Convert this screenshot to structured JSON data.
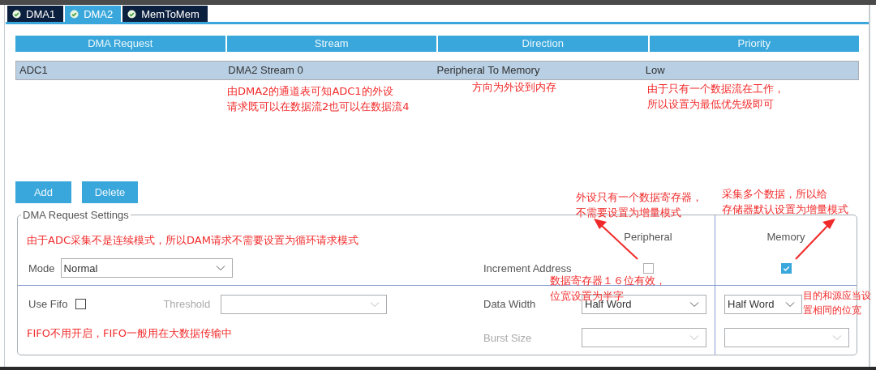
{
  "tabs": [
    {
      "label": "DMA1",
      "selected": false,
      "ok": true
    },
    {
      "label": "DMA2",
      "selected": true,
      "ok": true
    },
    {
      "label": "MemToMem",
      "selected": false,
      "ok": true
    }
  ],
  "table": {
    "columns": [
      "DMA Request",
      "Stream",
      "Direction",
      "Priority"
    ],
    "rows": [
      {
        "cells": [
          "ADC1",
          "DMA2 Stream 0",
          "Peripheral To Memory",
          "Low"
        ],
        "selected": true
      }
    ]
  },
  "buttons": [
    "Add",
    "Delete"
  ],
  "settings": {
    "title": "DMA Request Settings",
    "mode": {
      "label": "Mode",
      "value": "Normal"
    },
    "use_fifo": {
      "label": "Use Fifo",
      "checked": false
    },
    "threshold": {
      "label": "Threshold",
      "disabled": true
    },
    "column_headers": [
      "Peripheral",
      "Memory"
    ],
    "increment_address": {
      "label": "Increment Address",
      "peripheral": {
        "checked": false,
        "disabled": true
      },
      "memory": {
        "checked": true,
        "disabled": false
      }
    },
    "data_width": {
      "label": "Data Width",
      "peripheral": "Half Word",
      "memory": "Half Word"
    },
    "burst_size": {
      "label": "Burst Size",
      "disabled": true
    }
  },
  "annotations": [
    {
      "lines": [
        "由DMA2的通道表可知ADC1的外设",
        "请求既可以在数据流2也可以在数据流4"
      ]
    },
    {
      "lines": [
        "方向为外设到内存"
      ]
    },
    {
      "lines": [
        "由于只有一个数据流在工作，",
        "所以设置为最低优先级即可"
      ]
    },
    {
      "lines": [
        "外设只有一个数据寄存器，",
        "不需要设置为增量模式"
      ]
    },
    {
      "lines": [
        "采集多个数据，所以给",
        "存储器默认设置为增量模式"
      ]
    },
    {
      "lines": [
        "由于ADC采集不是连续模式，所以DAM请求不需要设置为循环请求模式"
      ]
    },
    {
      "lines": [
        "数据寄存器１６位有效，",
        "位宽设置为半字"
      ]
    },
    {
      "lines": [
        "目的和源应当设",
        "置相同的位宽"
      ]
    },
    {
      "lines": [
        "FIFO不用开启，FIFO一般用在大数据传输中"
      ]
    }
  ]
}
